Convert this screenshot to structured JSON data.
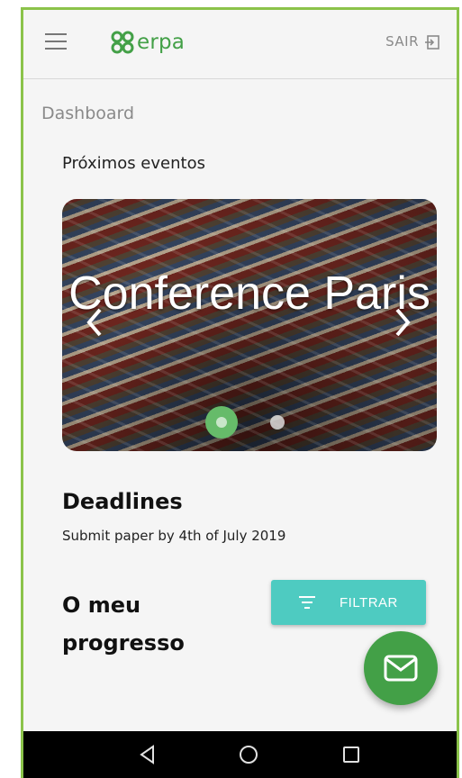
{
  "appbar": {
    "logo_text": "erpa",
    "logout_label": "SAIR",
    "icons": {
      "menu": "menu-icon",
      "logout": "exit-icon",
      "logo": "erpa-logo-icon"
    }
  },
  "breadcrumb": {
    "label": "Dashboard"
  },
  "events": {
    "section_title": "Próximos eventos",
    "slides": [
      {
        "title": "Conference Paris",
        "active": true
      },
      {
        "title": "",
        "active": false
      }
    ]
  },
  "deadlines": {
    "title": "Deadlines",
    "text": "Submit paper by 4th of July 2019"
  },
  "progress": {
    "title": "O meu progresso",
    "filter_label": "FILTRAR"
  },
  "fab": {
    "icon": "mail-icon"
  },
  "system_nav": {
    "icons": [
      "back-icon",
      "home-icon",
      "recent-apps-icon"
    ]
  },
  "colors": {
    "accent_green": "#43a047",
    "frame_green": "#8bc34a",
    "teal": "#4ecbc1",
    "background": "#f5f5f5"
  }
}
